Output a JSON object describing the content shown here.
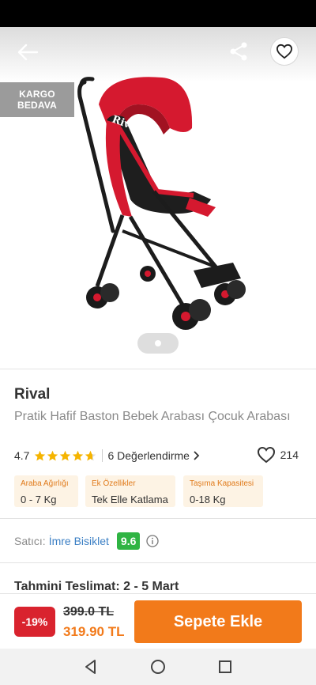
{
  "product": {
    "brand": "Rival",
    "title": "Pratik Hafif Baston Bebek Arabası Çocuk Arabası",
    "cargo_badge_line1": "KARGO",
    "cargo_badge_line2": "BEDAVA",
    "stroller_brand_mark": "Rival",
    "image_page": 1,
    "image_count": 1
  },
  "rating": {
    "value": "4.7",
    "stars": 4.7,
    "reviews_label": "6 Değerlendirme",
    "favorites_count": "214"
  },
  "attributes": [
    {
      "label": "Araba Ağırlığı",
      "value": "0 - 7 Kg"
    },
    {
      "label": "Ek Özellikler",
      "value": "Tek Elle Katlama"
    },
    {
      "label": "Taşıma Kapasitesi",
      "value": "0-18 Kg"
    }
  ],
  "seller": {
    "label": "Satıcı:",
    "name": "İmre Bisiklet",
    "score": "9.6"
  },
  "delivery": {
    "text": "Tahmini Teslimat: 2 - 5 Mart"
  },
  "purchase": {
    "discount": "-19%",
    "old_price": "399.0 TL",
    "new_price": "319.90 TL",
    "add_to_cart": "Sepete Ekle"
  },
  "icons": {
    "back": "arrow-left-icon",
    "share": "share-icon",
    "favorite": "heart-icon",
    "star": "star-icon",
    "chevron": "chevron-right-icon",
    "info": "info-icon",
    "nav_back": "triangle-back-icon",
    "nav_home": "circle-home-icon",
    "nav_recent": "square-recent-icon"
  },
  "colors": {
    "accent": "#f27a1a",
    "discount": "#d9232e",
    "seller_score": "#2fb443",
    "link": "#3b7fc4",
    "star": "#f5b400"
  }
}
